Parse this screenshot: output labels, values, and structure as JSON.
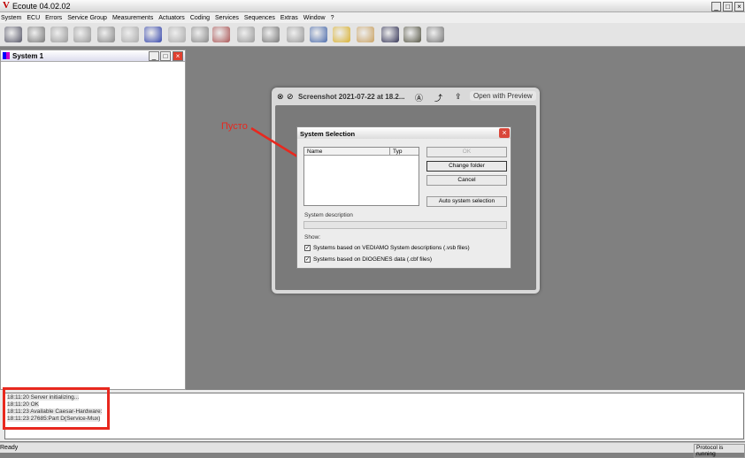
{
  "app": {
    "title": "Ecoute 04.02.02",
    "logo": "V"
  },
  "menu": [
    "System",
    "ECU",
    "Errors",
    "Service Group",
    "Measurements",
    "Actuators",
    "Coding",
    "Services",
    "Sequences",
    "Extras",
    "Window",
    "?"
  ],
  "toolbar_icons": [
    "connect-icon",
    "disconnect-icon",
    "check-icon",
    "no-check-icon",
    "device-icon",
    "measure-icon",
    "car-icon",
    "panel-icon",
    "folder-icon",
    "eye-icon",
    "tree-icon",
    "flash-icon",
    "list-icon",
    "table-icon",
    "folder-edit-icon",
    "tools-icon",
    "binoculars-icon",
    "plug-icon",
    "plug-remove-icon"
  ],
  "system_window": {
    "title": "System 1"
  },
  "preview": {
    "title": "Screenshot 2021-07-22 at 18.2...",
    "open_label": "Open with Preview"
  },
  "annotation": {
    "text": "Пусто",
    "color": "#e8281e"
  },
  "dialog": {
    "title": "System Selection",
    "columns": [
      "Name",
      "Typ"
    ],
    "ok": "OK",
    "change_folder": "Change folder",
    "cancel": "Cancel",
    "auto": "Auto system selection",
    "desc_label": "System description",
    "show_label": "Show:",
    "check1": "Systems based on VEDIAMO System descriptions (.vsb files)",
    "check2": "Systems based on DIOGENES data (.cbf files)"
  },
  "log": [
    "18:11:20 Server initializing...",
    "18:11:20 OK",
    "18:11:23 Available Caesar-Hardware:",
    "18:11:23 27685:Part D(Service-Mux)"
  ],
  "status": {
    "left": "Ready",
    "right": "Protocol is running"
  }
}
